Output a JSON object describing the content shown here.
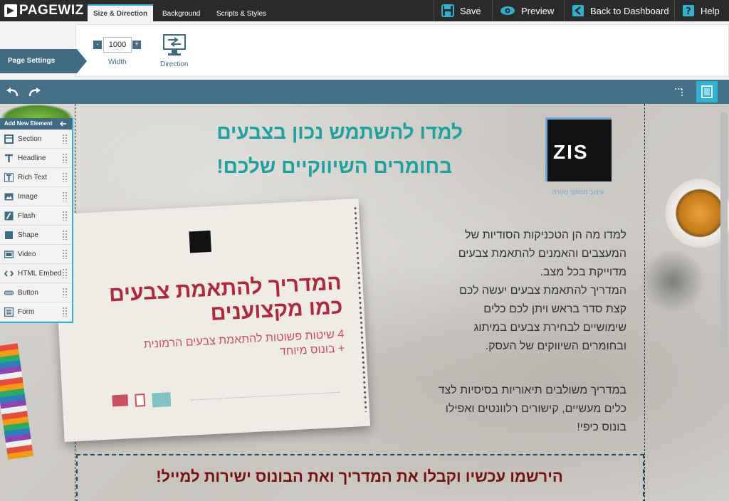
{
  "app": {
    "name": "PAGEWIZ"
  },
  "tabs": [
    {
      "label": "Size & Direction",
      "active": true
    },
    {
      "label": "Background",
      "active": false
    },
    {
      "label": "Scripts & Styles",
      "active": false
    }
  ],
  "actions": {
    "save": "Save",
    "preview": "Preview",
    "dashboard": "Back to Dashboard",
    "help": "Help"
  },
  "settings": {
    "section_label": "Page Settings",
    "width_value": "1000",
    "width_label": "Width",
    "direction_label": "Direction",
    "minus": "-",
    "plus": "+"
  },
  "sidebar": {
    "header": "Add New Element",
    "items": [
      {
        "label": "Section",
        "icon": "section-icon"
      },
      {
        "label": "Headline",
        "icon": "headline-icon"
      },
      {
        "label": "Rich Text",
        "icon": "rich-text-icon"
      },
      {
        "label": "Image",
        "icon": "image-icon"
      },
      {
        "label": "Flash",
        "icon": "flash-icon"
      },
      {
        "label": "Shape",
        "icon": "shape-icon"
      },
      {
        "label": "Video",
        "icon": "video-icon"
      },
      {
        "label": "HTML Embed",
        "icon": "code-icon"
      },
      {
        "label": "Button",
        "icon": "button-icon"
      },
      {
        "label": "Form",
        "icon": "form-icon"
      }
    ]
  },
  "page": {
    "headline_line1": "למדו להשתמש נכון בצבעים",
    "headline_line2": "בחומרים השיווקיים שלכם!",
    "logo_text": "ZIS",
    "logo_caption": "עיצוב ממוקד מטרה",
    "body_lines": [
      "למדו מה הן הטכניקות הסודיות של",
      "המעצבים והאמנים להתאמת צבעים",
      "מדוייקת בכל מצב.",
      "המדריך להתאמת צבעים יעשה לכם",
      "קצת סדר בראש ויתן לכם כלים",
      "שימושיים לבחירת צבעים במיתוג",
      "ובחומרים השיווקים של העסק."
    ],
    "body2_lines": [
      "במדריך משולבים תיאוריות בסיסיות לצד",
      "כלים מעשיים, קישורים רלוונטים ואפילו",
      "בונוס כיפי!"
    ],
    "book_title_line1": "המדריך להתאמת צבעים",
    "book_title_line2": "כמו מקצוענים",
    "book_sub_line1": "4 שיטות פשוטות להתאמת צבעים הרמונית",
    "book_sub_line2": "+ בונוס מיוחד",
    "cta": "הירשמו עכשיו וקבלו את המדריך ואת הבונוס ישירות למייל!"
  },
  "colors": {
    "topbar": "#2b2b2b",
    "accent": "#3f6b83",
    "tab_highlight": "#2bb3d4",
    "headline": "#1aa3a1",
    "book_title": "#b0283c",
    "cta": "#7a0f0f"
  }
}
